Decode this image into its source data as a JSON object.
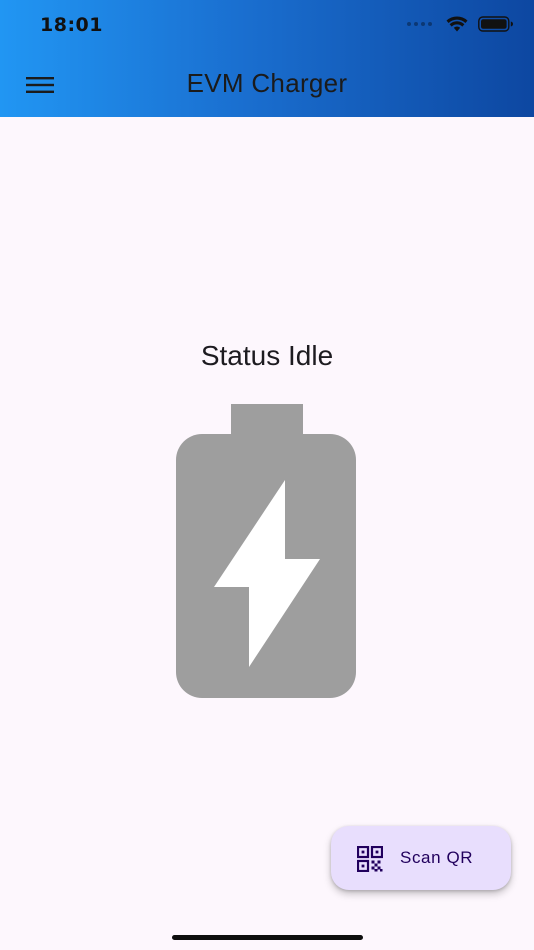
{
  "status_bar": {
    "time": "18:01"
  },
  "app_bar": {
    "title": "EVM Charger",
    "menu_icon": "hamburger-menu-icon"
  },
  "main": {
    "status_text": "Status Idle",
    "battery_icon": "battery-charging-icon"
  },
  "fab": {
    "label": "Scan QR",
    "icon": "qr-code-icon"
  },
  "colors": {
    "appbar_start": "#2196f3",
    "appbar_end": "#0d47a1",
    "background": "#fdf7fd",
    "battery": "#9e9e9e",
    "fab_background": "#e8defd",
    "fab_text": "#21005d"
  }
}
